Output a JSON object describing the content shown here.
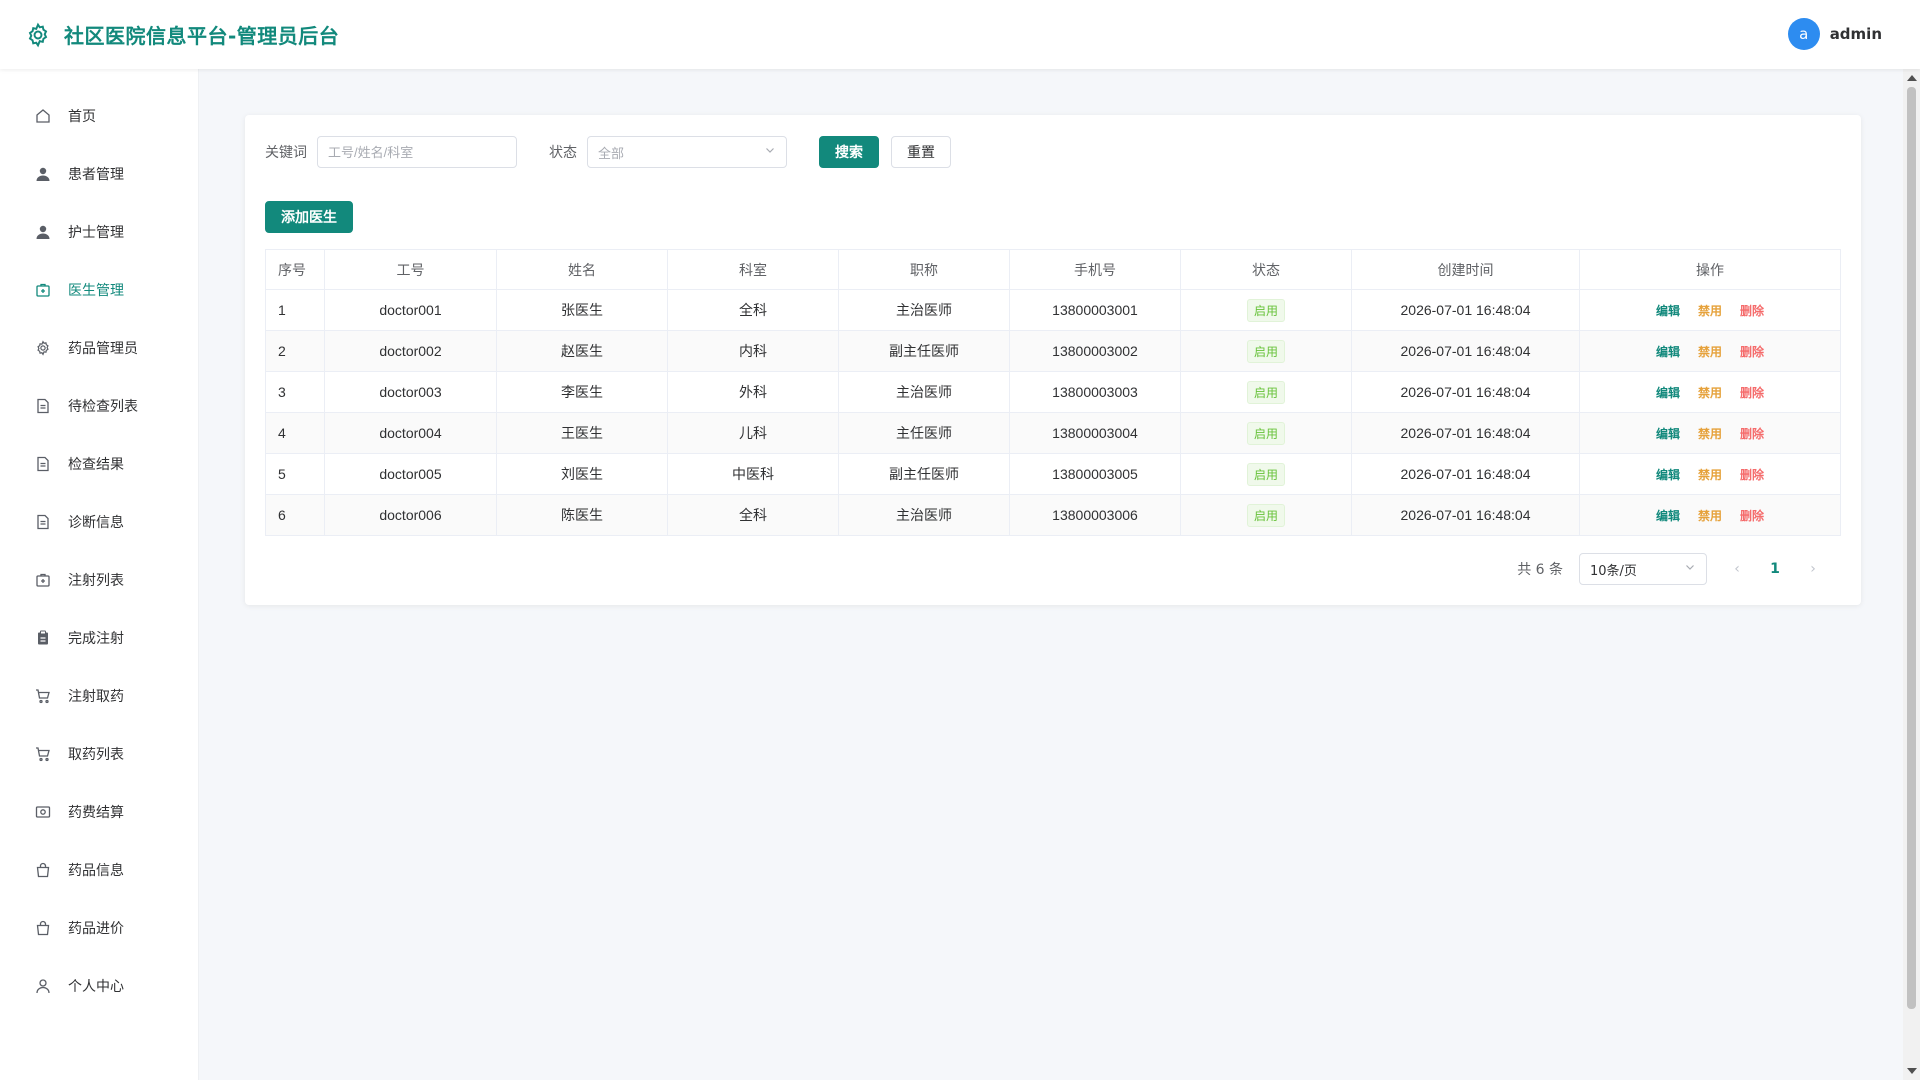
{
  "header": {
    "title": "社区医院信息平台-管理员后台",
    "avatar_letter": "a",
    "username": "admin",
    "brand_color": "#12897c"
  },
  "sidebar": {
    "items": [
      {
        "label": "首页",
        "icon": "home-icon"
      },
      {
        "label": "患者管理",
        "icon": "user-icon"
      },
      {
        "label": "护士管理",
        "icon": "user-icon"
      },
      {
        "label": "医生管理",
        "icon": "medical-kit-icon",
        "active": true
      },
      {
        "label": "药品管理员",
        "icon": "gear-icon"
      },
      {
        "label": "待检查列表",
        "icon": "document-icon"
      },
      {
        "label": "检查结果",
        "icon": "document-icon"
      },
      {
        "label": "诊断信息",
        "icon": "document-icon"
      },
      {
        "label": "注射列表",
        "icon": "medical-kit-icon"
      },
      {
        "label": "完成注射",
        "icon": "clipboard-icon"
      },
      {
        "label": "注射取药",
        "icon": "cart-icon"
      },
      {
        "label": "取药列表",
        "icon": "cart-icon"
      },
      {
        "label": "药费结算",
        "icon": "money-icon"
      },
      {
        "label": "药品信息",
        "icon": "bag-icon"
      },
      {
        "label": "药品进价",
        "icon": "bag-icon"
      },
      {
        "label": "个人中心",
        "icon": "person-outline-icon"
      }
    ]
  },
  "filters": {
    "keyword_label": "关键词",
    "keyword_placeholder": "工号/姓名/科室",
    "keyword_value": "",
    "status_label": "状态",
    "status_value": "全部",
    "search_label": "搜索",
    "reset_label": "重置"
  },
  "actions": {
    "add_label": "添加医生"
  },
  "table": {
    "columns": [
      "序号",
      "工号",
      "姓名",
      "科室",
      "职称",
      "手机号",
      "状态",
      "创建时间",
      "操作"
    ],
    "rows": [
      {
        "index": "1",
        "code": "doctor001",
        "name": "张医生",
        "dept": "全科",
        "title": "主治医师",
        "phone": "13800003001",
        "status": "启用",
        "created": "2026-07-01 16:48:04"
      },
      {
        "index": "2",
        "code": "doctor002",
        "name": "赵医生",
        "dept": "内科",
        "title": "副主任医师",
        "phone": "13800003002",
        "status": "启用",
        "created": "2026-07-01 16:48:04"
      },
      {
        "index": "3",
        "code": "doctor003",
        "name": "李医生",
        "dept": "外科",
        "title": "主治医师",
        "phone": "13800003003",
        "status": "启用",
        "created": "2026-07-01 16:48:04"
      },
      {
        "index": "4",
        "code": "doctor004",
        "name": "王医生",
        "dept": "儿科",
        "title": "主任医师",
        "phone": "13800003004",
        "status": "启用",
        "created": "2026-07-01 16:48:04"
      },
      {
        "index": "5",
        "code": "doctor005",
        "name": "刘医生",
        "dept": "中医科",
        "title": "副主任医师",
        "phone": "13800003005",
        "status": "启用",
        "created": "2026-07-01 16:48:04"
      },
      {
        "index": "6",
        "code": "doctor006",
        "name": "陈医生",
        "dept": "全科",
        "title": "主治医师",
        "phone": "13800003006",
        "status": "启用",
        "created": "2026-07-01 16:48:04"
      }
    ],
    "ops": {
      "edit": "编辑",
      "disable": "禁用",
      "delete": "删除"
    }
  },
  "pagination": {
    "total_text": "共 6 条",
    "page_size": "10条/页",
    "current_page": "1"
  }
}
